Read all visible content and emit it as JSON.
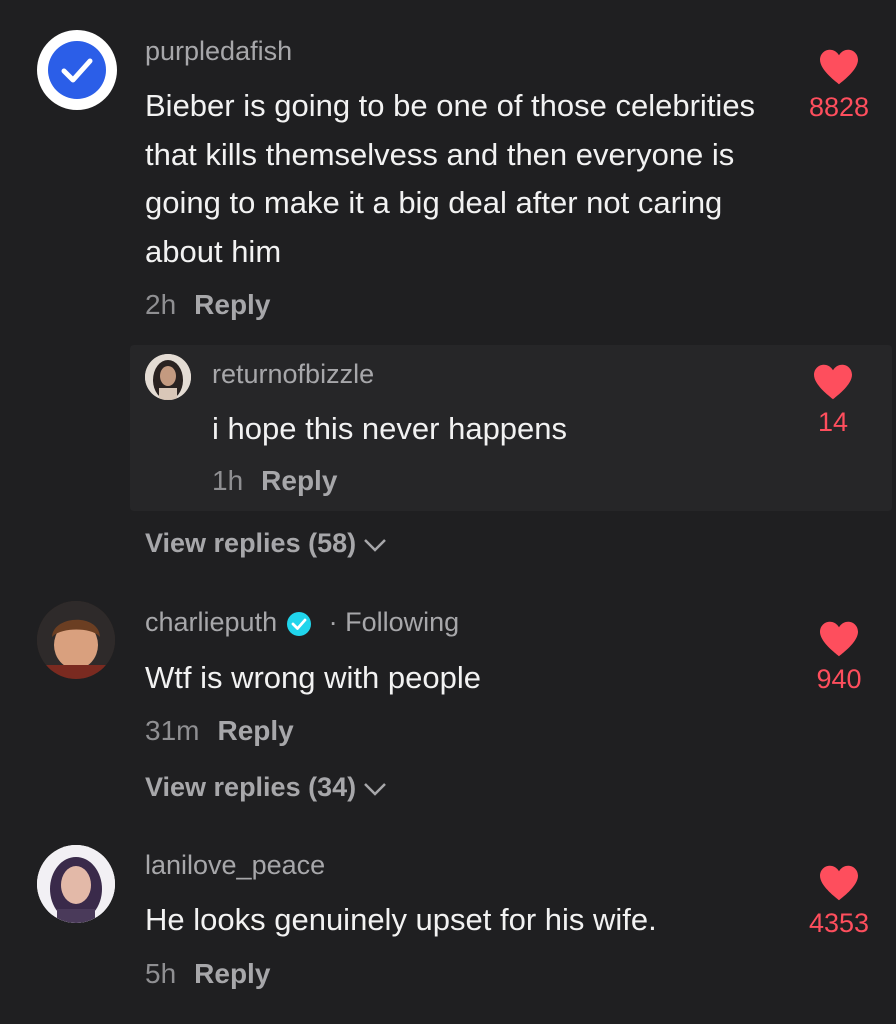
{
  "comments": [
    {
      "username": "purpledafish",
      "text": "Bieber is going to be one of those celebrities that kills themselvess and then everyone is going to make it a big deal after not caring about him",
      "time": "2h",
      "reply_label": "Reply",
      "likes": "8828",
      "view_replies": "View replies (58)",
      "reply": {
        "username": "returnofbizzle",
        "text": "i hope this never happens",
        "time": "1h",
        "reply_label": "Reply",
        "likes": "14"
      }
    },
    {
      "username": "charlieputh",
      "following_label": "· Following",
      "text": "Wtf is wrong with people",
      "time": "31m",
      "reply_label": "Reply",
      "likes": "940",
      "view_replies": "View replies (34)"
    },
    {
      "username": "lanilove_peace",
      "text": "He looks genuinely upset for his wife.",
      "time": "5h",
      "reply_label": "Reply",
      "likes": "4353"
    }
  ],
  "colors": {
    "background": "#1f1f21",
    "like_red": "#fe4e5d",
    "verified_blue": "#20d5ec",
    "check_blue": "#2563eb"
  },
  "icons": [
    "check-icon",
    "heart-icon",
    "chevron-down-icon",
    "verified-icon"
  ]
}
